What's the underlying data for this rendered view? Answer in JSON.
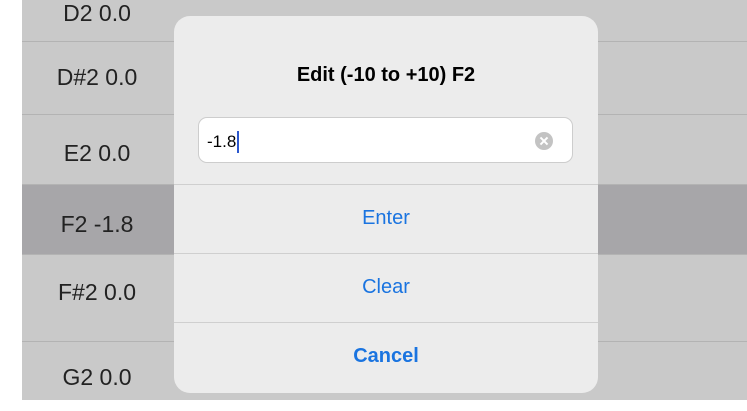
{
  "list": {
    "rows": [
      {
        "label": "D2 0.0",
        "selected": false
      },
      {
        "label": "D#2 0.0",
        "selected": false
      },
      {
        "label": "E2 0.0",
        "selected": false
      },
      {
        "label": "F2 -1.8",
        "selected": true
      },
      {
        "label": "F#2 0.0",
        "selected": false
      },
      {
        "label": "G2 0.0",
        "selected": false
      }
    ]
  },
  "dialog": {
    "title": "Edit (-10 to +10) F2",
    "input": {
      "value": "-1.8"
    },
    "actions": {
      "enter": "Enter",
      "clear": "Clear",
      "cancel": "Cancel"
    }
  }
}
